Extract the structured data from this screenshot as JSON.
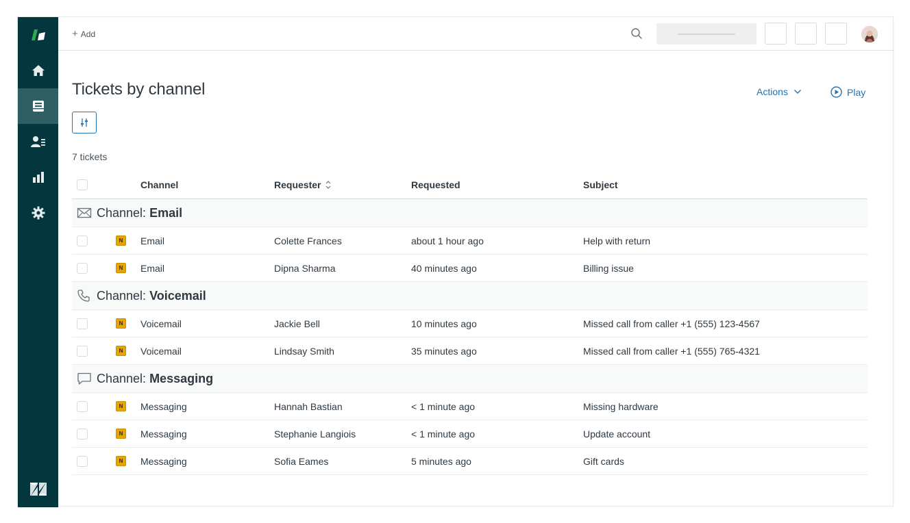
{
  "topbar": {
    "add_label": "Add"
  },
  "page": {
    "title": "Tickets by channel",
    "actions_label": "Actions",
    "play_label": "Play",
    "ticket_count": "7 tickets"
  },
  "table": {
    "headers": {
      "channel": "Channel",
      "requester": "Requester",
      "requested": "Requested",
      "subject": "Subject"
    },
    "groups": [
      {
        "prefix": "Channel:",
        "name": "Email",
        "icon": "envelope-icon",
        "rows": [
          {
            "status": "N",
            "channel": "Email",
            "requester": "Colette Frances",
            "requested": "about 1 hour ago",
            "subject": "Help with return"
          },
          {
            "status": "N",
            "channel": "Email",
            "requester": "Dipna Sharma",
            "requested": "40 minutes ago",
            "subject": "Billing issue"
          }
        ]
      },
      {
        "prefix": "Channel:",
        "name": "Voicemail",
        "icon": "phone-icon",
        "rows": [
          {
            "status": "N",
            "channel": "Voicemail",
            "requester": "Jackie Bell",
            "requested": "10 minutes ago",
            "subject": "Missed call from caller +1 (555) 123-4567"
          },
          {
            "status": "N",
            "channel": "Voicemail",
            "requester": "Lindsay Smith",
            "requested": "35 minutes ago",
            "subject": "Missed call from caller +1 (555) 765-4321"
          }
        ]
      },
      {
        "prefix": "Channel:",
        "name": "Messaging",
        "icon": "chat-bubble-icon",
        "rows": [
          {
            "status": "N",
            "channel": "Messaging",
            "requester": "Hannah Bastian",
            "requested": "< 1 minute ago",
            "subject": "Missing hardware"
          },
          {
            "status": "N",
            "channel": "Messaging",
            "requester": "Stephanie Langiois",
            "requested": "< 1 minute ago",
            "subject": "Update account"
          },
          {
            "status": "N",
            "channel": "Messaging",
            "requester": "Sofia Eames",
            "requested": "5 minutes ago",
            "subject": "Gift cards"
          }
        ]
      }
    ]
  },
  "colors": {
    "sidebar": "#03363d",
    "sidebar_active": "#2f5f63",
    "accent": "#1f73b7",
    "status_new": "#e8a500",
    "brand_green": "#30aa4d"
  }
}
